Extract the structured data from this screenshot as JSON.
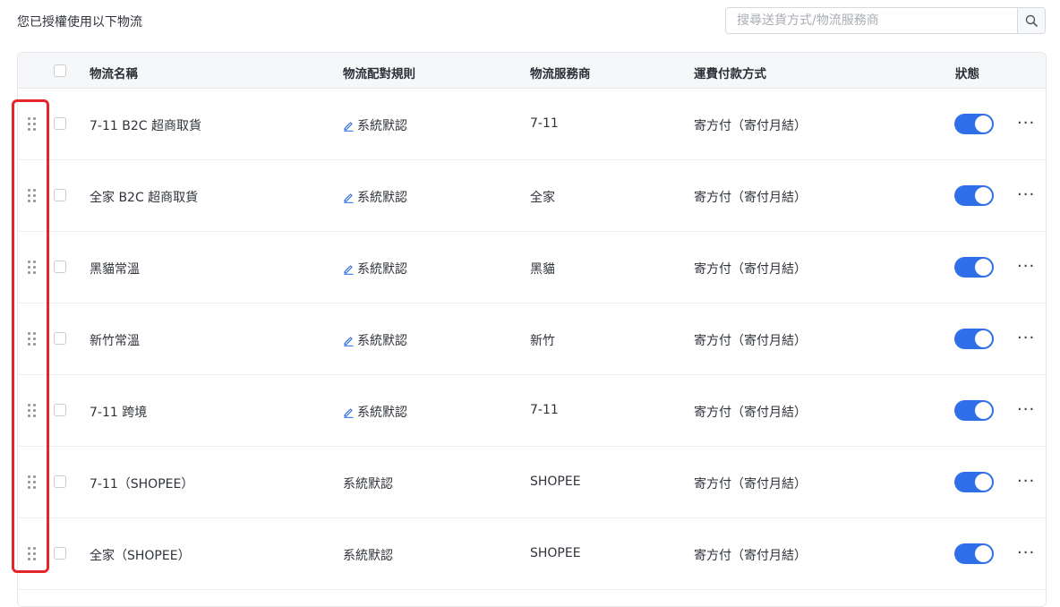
{
  "header": {
    "intro_text": "您已授權使用以下物流",
    "search_placeholder": "搜尋送貨方式/物流服務商",
    "search_icon": "search-icon"
  },
  "table": {
    "columns": {
      "name": "物流名稱",
      "rule": "物流配對規則",
      "provider": "物流服務商",
      "payment": "運費付款方式",
      "status": "狀態"
    },
    "rows": [
      {
        "name": "7-11 B2C 超商取貨",
        "rule": "系統默認",
        "rule_editable": true,
        "provider": "7-11",
        "payment": "寄方付（寄付月結）",
        "enabled": true,
        "more": "···"
      },
      {
        "name": "全家 B2C 超商取貨",
        "rule": "系統默認",
        "rule_editable": true,
        "provider": "全家",
        "payment": "寄方付（寄付月結）",
        "enabled": true,
        "more": "···"
      },
      {
        "name": "黑貓常溫",
        "rule": "系統默認",
        "rule_editable": true,
        "provider": "黑貓",
        "payment": "寄方付（寄付月結）",
        "enabled": true,
        "more": "···"
      },
      {
        "name": "新竹常溫",
        "rule": "系統默認",
        "rule_editable": true,
        "provider": "新竹",
        "payment": "寄方付（寄付月結）",
        "enabled": true,
        "more": "···"
      },
      {
        "name": "7-11 跨境",
        "rule": "系統默認",
        "rule_editable": true,
        "provider": "7-11",
        "payment": "寄方付（寄付月結）",
        "enabled": true,
        "more": "···"
      },
      {
        "name": "7-11（SHOPEE）",
        "rule": "系統默認",
        "rule_editable": false,
        "provider": "SHOPEE",
        "payment": "寄方付（寄付月結）",
        "enabled": true,
        "more": "···"
      },
      {
        "name": "全家（SHOPEE）",
        "rule": "系統默認",
        "rule_editable": false,
        "provider": "SHOPEE",
        "payment": "寄方付（寄付月結）",
        "enabled": true,
        "more": "···"
      }
    ]
  },
  "colors": {
    "toggle_on": "#2f6fe8",
    "highlight_border": "#e5262b",
    "edit_icon": "#2f6fe8"
  }
}
